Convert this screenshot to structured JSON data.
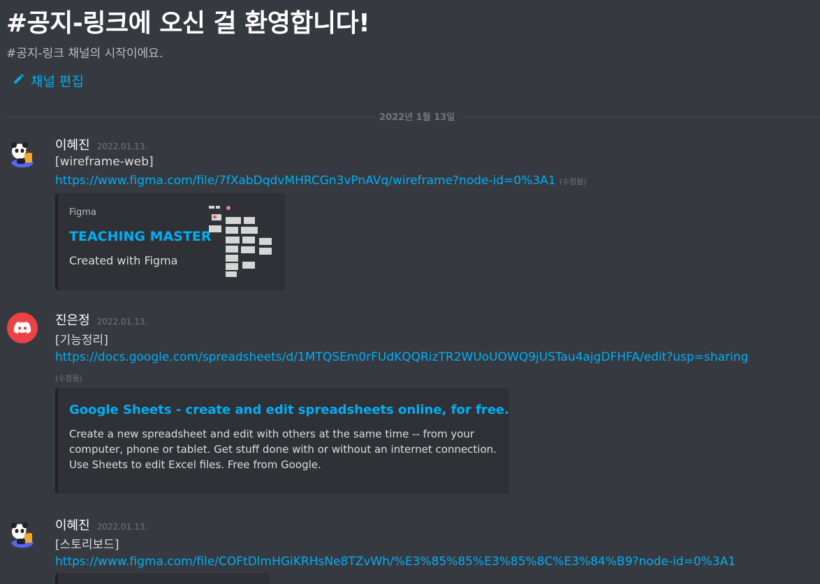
{
  "channel": {
    "welcome_title": "#공지-링크에 오신 걸 환영합니다!",
    "welcome_subtitle": "#공지-링크 채널의 시작이에요.",
    "edit_label": "채널 편집",
    "date_separator": "2022년 1월 13일"
  },
  "messages": [
    {
      "author": "이혜진",
      "timestamp": "2022.01.13.",
      "avatar": "panda-avatar",
      "text": "[wireframe-web]",
      "link": "https://www.figma.com/file/7fXabDqdvMHRCGn3vPnAVq/wireframe?node-id=0%3A1",
      "edited": "(수정됨)",
      "embed": {
        "provider": "Figma",
        "title": "TEACHING MASTER",
        "description": "Created with Figma",
        "thumbnail": "figma-wireframe-thumbnail"
      }
    },
    {
      "author": "진은정",
      "timestamp": "2022.01.13.",
      "avatar": "discord-avatar",
      "text": "[기능정리]",
      "link": "https://docs.google.com/spreadsheets/d/1MTQSEm0rFUdKQQRizTR2WUoUOWQ9jUSTau4ajgDFHFA/edit?usp=sharing",
      "edited": "(수정됨)",
      "embed": {
        "title": "Google Sheets - create and edit spreadsheets online, for free.",
        "description_lines": [
          "Create a new spreadsheet and edit with others at the same time -- from your",
          "computer, phone or tablet. Get stuff done with or without an internet connection.",
          "Use Sheets to edit Excel files. Free from Google."
        ]
      }
    },
    {
      "author": "이혜진",
      "timestamp": "2022.01.13.",
      "avatar": "panda-avatar",
      "text": "[스토리보드]",
      "link": "https://www.figma.com/file/COFtDlmHGiKRHsNe8TZvWh/%E3%85%85%E3%85%8C%E3%84%B9?node-id=0%3A1"
    }
  ],
  "colors": {
    "background": "#36393f",
    "link": "#00aff4",
    "embed_bg": "#2f3136",
    "discord_red": "#ed4245"
  }
}
